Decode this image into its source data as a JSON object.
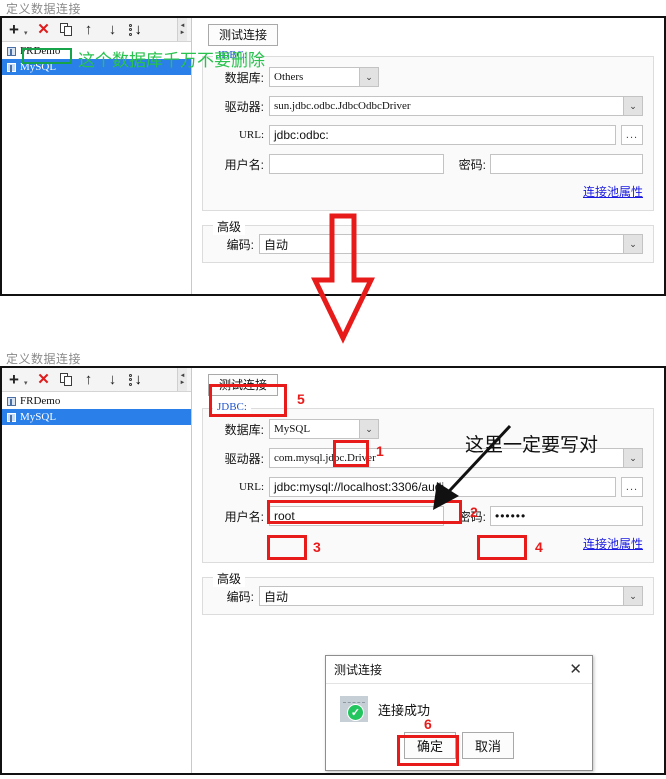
{
  "panels": [
    {
      "title": "定义数据连接",
      "toolbar": {
        "add_label": "+",
        "add_caret": "▾",
        "delete_label": "✕",
        "copy_name": "copy-icon",
        "up_label": "↑",
        "down_label": "↓",
        "move_bottom_label": "↓"
      },
      "list": [
        {
          "label": "FRDemo",
          "selected": false
        },
        {
          "label": "MySQL",
          "selected": true
        }
      ],
      "test_button": "测试连接",
      "jdbc_legend": "JDBC:",
      "fields": {
        "database_label": "数据库:",
        "database_value": "Others",
        "driver_label": "驱动器:",
        "driver_value": "sun.jdbc.odbc.JdbcOdbcDriver",
        "url_label": "URL:",
        "url_value": "jdbc:odbc:",
        "url_browse": "...",
        "user_label": "用户名:",
        "user_value": "",
        "password_label": "密码:",
        "password_value": ""
      },
      "pool_link": "连接池属性",
      "advanced_legend": "高级",
      "encoding_label": "编码:",
      "encoding_value": "自动"
    },
    {
      "title": "定义数据连接",
      "toolbar": {
        "add_label": "+",
        "add_caret": "▾",
        "delete_label": "✕",
        "copy_name": "copy-icon",
        "up_label": "↑",
        "down_label": "↓",
        "move_bottom_label": "↓"
      },
      "list": [
        {
          "label": "FRDemo",
          "selected": false
        },
        {
          "label": "MySQL",
          "selected": true
        }
      ],
      "test_button": "测试连接",
      "jdbc_legend": "JDBC:",
      "fields": {
        "database_label": "数据库:",
        "database_value": "MySQL",
        "driver_label": "驱动器:",
        "driver_value": "com.mysql.jdbc.Driver",
        "url_label": "URL:",
        "url_value": "jdbc:mysql://localhost:3306/audi",
        "url_browse": "...",
        "user_label": "用户名:",
        "user_value": "root",
        "password_label": "密码:",
        "password_value": "••••••"
      },
      "pool_link": "连接池属性",
      "advanced_legend": "高级",
      "encoding_label": "高级",
      "encoding_field_label": "编码:",
      "encoding_value": "自动"
    }
  ],
  "annotations": {
    "green_note": "这个数据库千万不要删除",
    "black_note": "这里一定要写对",
    "steps": {
      "one": "1",
      "two": "2",
      "three": "3",
      "four": "4",
      "five": "5",
      "six": "6"
    }
  },
  "dialog": {
    "title": "测试连接",
    "close_label": "✕",
    "message": "连接成功",
    "check_glyph": "✓",
    "ok_label": "确定",
    "cancel_label": "取消"
  }
}
